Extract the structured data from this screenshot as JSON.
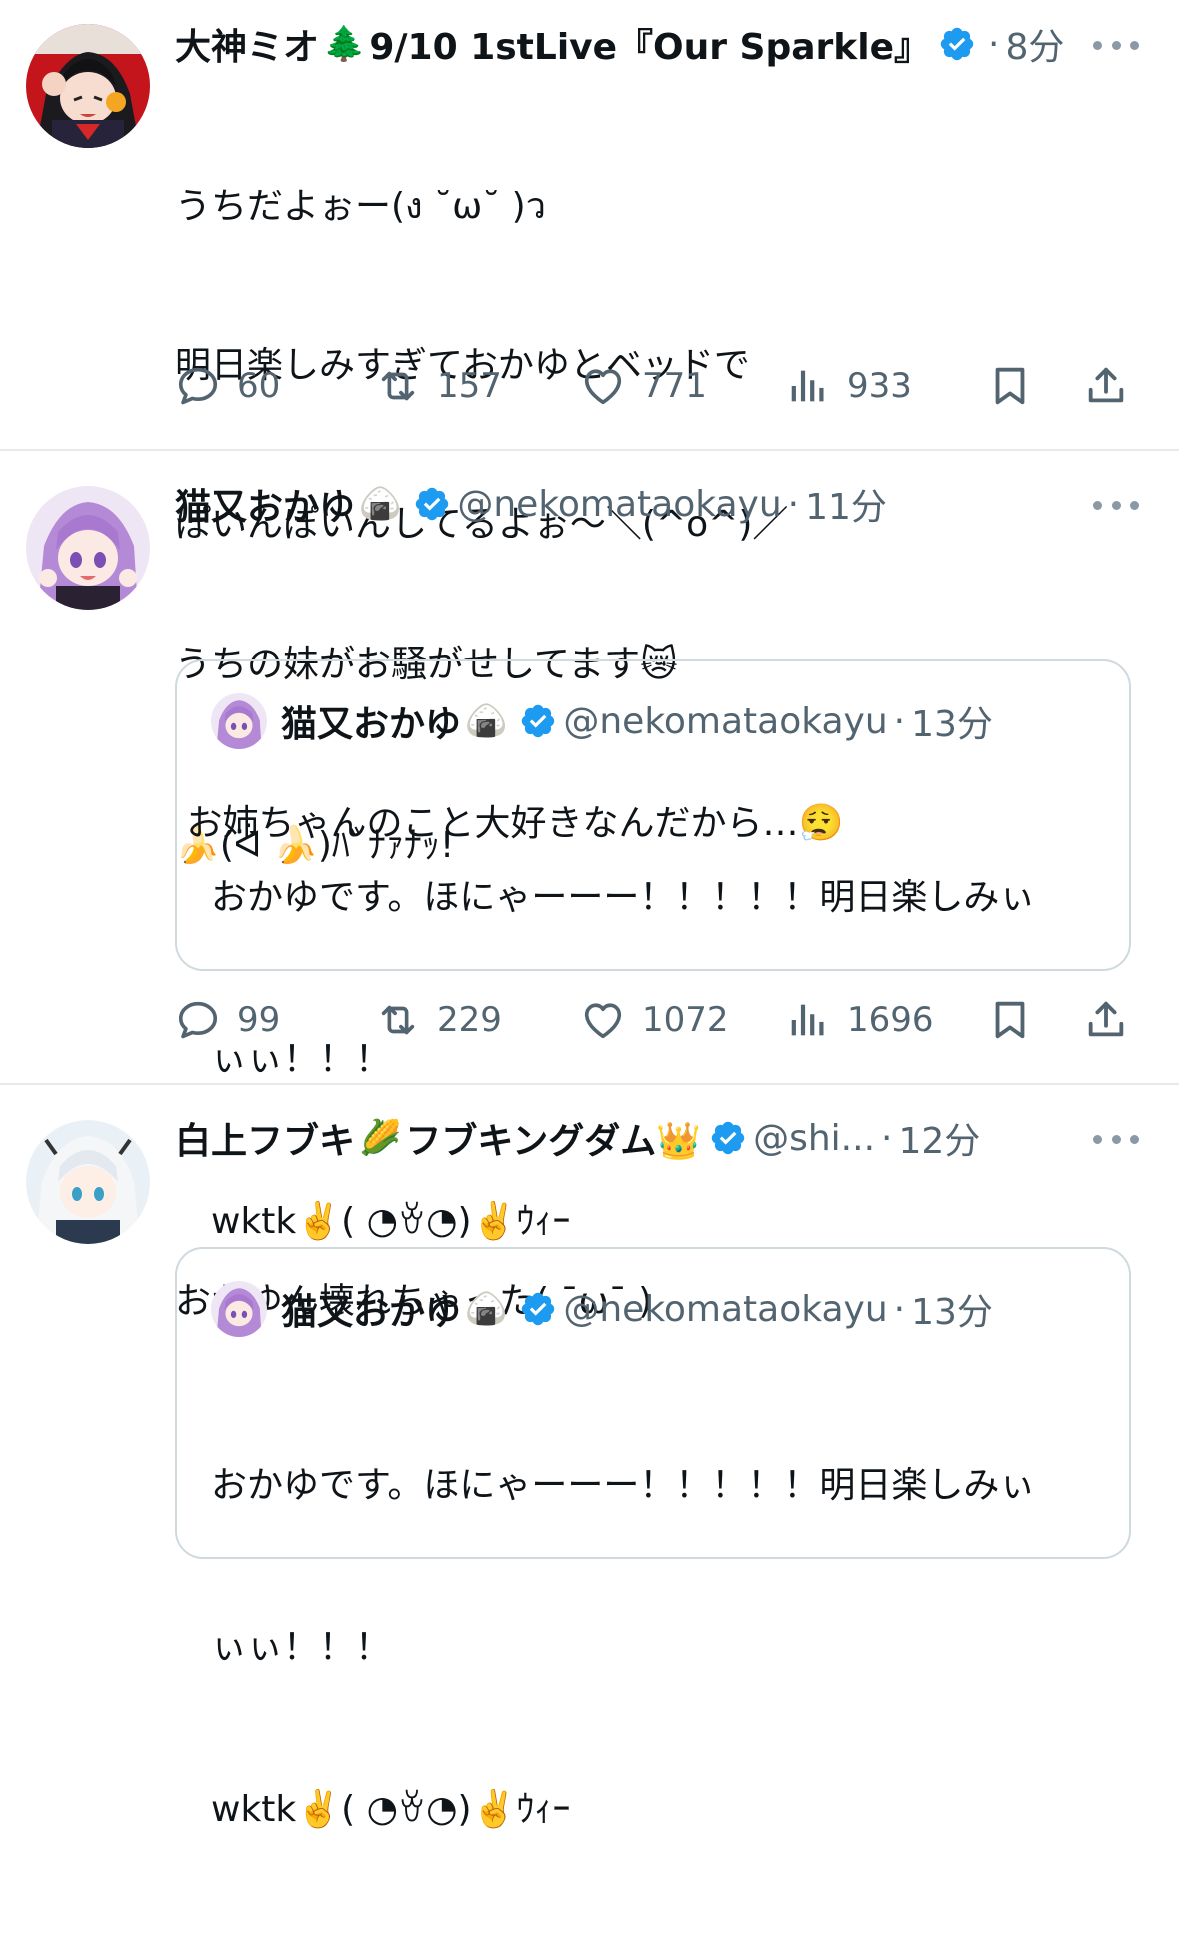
{
  "tweets": [
    {
      "display_name": "大神ミオ",
      "name_emoji": "🌲",
      "name_suffix": "9/10 1stLive『Our Sparkle』",
      "handle": "",
      "time": "8分",
      "lines": [
        "うちだよぉー(ง ˘ω˘ )ว",
        "明日楽しみすぎておかゆとベッドで",
        "ぽいんぽいんしてるよぉ～＼(^o^)／",
        "",
        "🍌(ᐛ 🍌)ﾊﾞﾅｧﾅｯ!"
      ],
      "stats": {
        "replies": "60",
        "retweets": "157",
        "likes": "771",
        "views": "933"
      }
    },
    {
      "display_name": "猫又おかゆ",
      "name_emoji": "🍙",
      "name_suffix": "",
      "handle": "@nekomataokayu",
      "time": "11分",
      "lines": [
        "うちの妹がお騒がせしてます😿",
        " お姉ちゃんのこと大好きなんだから…😮‍💨"
      ],
      "quote": {
        "display_name": "猫又おかゆ",
        "name_emoji": "🍙",
        "handle": "@nekomataokayu",
        "time": "13分",
        "lines": [
          "おかゆです。ほにゃーーー！！！！！明日楽しみぃ",
          "ぃぃ！！！",
          "wktk✌️( ◔ꈊ◔)✌️ｳｨｰ"
        ]
      },
      "stats": {
        "replies": "99",
        "retweets": "229",
        "likes": "1072",
        "views": "1696"
      }
    },
    {
      "display_name": "白上フブキ",
      "name_emoji": "🌽",
      "name_suffix": "フブキングダム👑",
      "handle": "@shi...",
      "time": "12分",
      "lines": [
        "おかゆん壊れちゃった( ¯ω¯ )"
      ],
      "quote": {
        "display_name": "猫又おかゆ",
        "name_emoji": "🍙",
        "handle": "@nekomataokayu",
        "time": "13分",
        "lines": [
          "おかゆです。ほにゃーーー！！！！！明日楽しみぃ",
          "ぃぃ！！！",
          "wktk✌️( ◔ꈊ◔)✌️ｳｨｰ"
        ]
      }
    }
  ],
  "separator_dot": "·",
  "icons": {
    "reply": "comment-bubble-icon",
    "retweet": "retweet-arrows-icon",
    "like": "heart-icon",
    "views": "bar-chart-icon",
    "bookmark": "bookmark-icon",
    "share": "share-upload-icon",
    "verified": "verified-badge-icon",
    "more": "more-dots-icon"
  },
  "colors": {
    "text": "#0f1419",
    "secondary": "#536471",
    "verified": "#1d9bf0",
    "divider": "#e7e9ea",
    "quote_border": "#cfd9de"
  }
}
